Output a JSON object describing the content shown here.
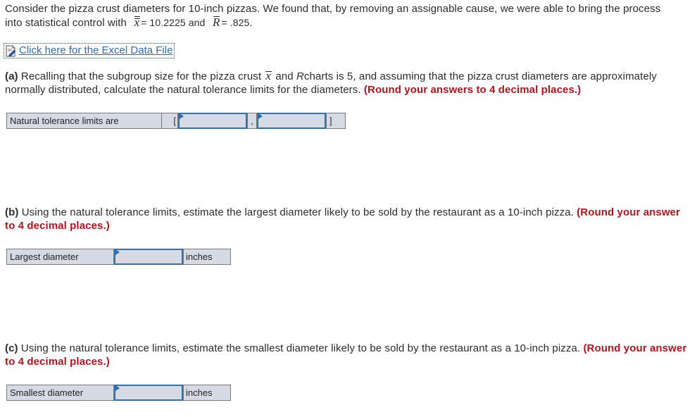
{
  "intro": {
    "text_before": "Consider the pizza crust diameters for 10-inch pizzas. We found that, by removing an assignable cause, we were able to bring the process into statistical control with",
    "xbarbar_symbol": "x",
    "xbarbar_value": "= 10.2225 and",
    "rbar_symbol": "R",
    "rbar_value": "= .825."
  },
  "excel_link": {
    "icon": "excel-file-icon",
    "label": "Click here for the Excel Data File"
  },
  "part_a": {
    "tag": "(a)",
    "text_1": "Recalling that the subgroup size for the pizza crust",
    "xbar_symbol": "x",
    "text_2": "and",
    "r_symbol": "R",
    "text_3": "charts is 5, and assuming that the pizza crust diameters are approximately normally distributed, calculate the natural tolerance limits for the diameters.",
    "round_note": "(Round your answers to 4 decimal places.)",
    "table": {
      "label": "Natural tolerance limits are",
      "open_bracket": "[",
      "separator": ",",
      "close_bracket": "]",
      "lower_value": "",
      "upper_value": ""
    }
  },
  "part_b": {
    "tag": "(b)",
    "text": "Using the natural tolerance limits, estimate the largest diameter likely to be sold by the restaurant as a 10-inch pizza.",
    "round_note": "(Round your answer to 4 decimal places.)",
    "table": {
      "label": "Largest diameter",
      "value": "",
      "unit": "inches"
    }
  },
  "part_c": {
    "tag": "(c)",
    "text": "Using the natural tolerance limits, estimate the smallest diameter likely to be sold by the restaurant as a 10-inch pizza.",
    "round_note": "(Round your answer to 4 decimal places.)",
    "table": {
      "label": "Smallest diameter",
      "value": "",
      "unit": "inches"
    }
  },
  "colors": {
    "round_note": "#b5121b",
    "link": "#2a6ebb",
    "input_border": "#3a6ea5",
    "table_bg": "#d5dae4"
  }
}
